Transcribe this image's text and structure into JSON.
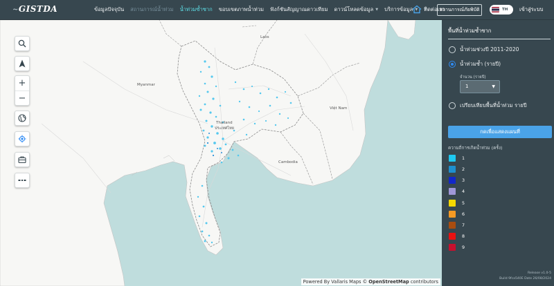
{
  "brand": {
    "logo_text": "GISTDA"
  },
  "nav": {
    "items": [
      {
        "label": "ข้อมูลปัจจุบัน",
        "state": "normal",
        "dropdown": false
      },
      {
        "label": "สถานการณ์น้ำท่วม",
        "state": "disabled",
        "dropdown": false
      },
      {
        "label": "น้ำท่วมซ้ำซาก",
        "state": "active",
        "dropdown": false
      },
      {
        "label": "ขอบเขตภาพน้ำท่วม",
        "state": "normal",
        "dropdown": false
      },
      {
        "label": "ฟังก์ชันสัญญาณดาวเทียม",
        "state": "normal",
        "dropdown": false
      },
      {
        "label": "ดาวน์โหลดข้อมูล",
        "state": "normal",
        "dropdown": true
      },
      {
        "label": "บริการข้อมูล",
        "state": "normal",
        "dropdown": true
      },
      {
        "label": "ติดต่อเรา",
        "state": "normal",
        "dropdown": false
      }
    ],
    "home_icon": "home-icon",
    "situation_button": "สถานการณ์ภัยพิบัติ",
    "language_code": "TH",
    "login_label": "เข้าสู่ระบบ"
  },
  "map": {
    "place_labels": {
      "laos": "Laos",
      "myanmar": "Myanmar",
      "thailand": "Thailand",
      "thailand_thai": "ประเทศไทย",
      "vietnam": "Việt Nam",
      "cambodia": "Cambodia"
    },
    "attribution": {
      "prefix": "Powered By Vallaris Maps",
      "osm": "OpenStreetMap",
      "suffix": "contributors"
    },
    "tools": [
      "search-icon",
      "north-arrow-icon",
      "zoom-in",
      "zoom-out",
      "globe-icon",
      "locate-icon",
      "briefcase-icon",
      "dashed-line-icon"
    ],
    "zoom_in_label": "+",
    "zoom_out_label": "−"
  },
  "panel": {
    "title": "พื้นที่น้ำท่วมซ้ำซาก",
    "options": [
      {
        "label": "น้ำท่วมช่วงปี 2011-2020",
        "checked": false
      },
      {
        "label": "น้ำท่วมซ้ำ (รายปี)",
        "checked": true
      },
      {
        "label": "เปรียบเทียบพื้นที่น้ำท่วม รายปี",
        "checked": false
      }
    ],
    "count_label": "จำนวน (รายปี)",
    "count_value": "1",
    "show_button": "กดเพื่อแสดงแผนที่",
    "legend_title": "ความถี่การเกิดน้ำท่วม (ครั้ง)",
    "legend": [
      {
        "label": "1",
        "color": "#1ec8f0"
      },
      {
        "label": "2",
        "color": "#1e90cf"
      },
      {
        "label": "3",
        "color": "#1227c9"
      },
      {
        "label": "4",
        "color": "#9f97d8"
      },
      {
        "label": "5",
        "color": "#f5d800"
      },
      {
        "label": "6",
        "color": "#f59a23"
      },
      {
        "label": "7",
        "color": "#a84d10"
      },
      {
        "label": "8",
        "color": "#e81212"
      },
      {
        "label": "9",
        "color": "#c8102e"
      }
    ],
    "release": "Release v1.0-5",
    "build": "Build 9fca540E  Date 26/08/2024"
  },
  "colors": {
    "accent": "#4aa3e8",
    "active_nav": "#5ee0e8",
    "panel_bg": "#37474f",
    "sea": "#bfdddd"
  }
}
